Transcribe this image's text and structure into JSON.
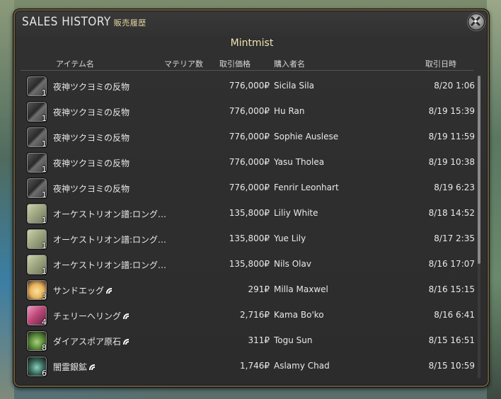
{
  "window": {
    "title": "SALES HISTORY",
    "title_jp": "販売履歴",
    "retainer_name": "Mintmist"
  },
  "columns": {
    "item": "アイテム名",
    "materia": "マテリア数",
    "price": "取引価格",
    "buyer": "購入者名",
    "datetime": "取引日時"
  },
  "rows": [
    {
      "icon": "cloth-bolt-icon",
      "qty": "1",
      "name": "夜神ツクヨミの反物",
      "hq": false,
      "price": "776,000₽",
      "buyer": "Sicila Sila",
      "date": "8/20 1:06"
    },
    {
      "icon": "cloth-bolt-icon",
      "qty": "1",
      "name": "夜神ツクヨミの反物",
      "hq": false,
      "price": "776,000₽",
      "buyer": "Hu Ran",
      "date": "8/19 15:39"
    },
    {
      "icon": "cloth-bolt-icon",
      "qty": "1",
      "name": "夜神ツクヨミの反物",
      "hq": false,
      "price": "776,000₽",
      "buyer": "Sophie Auslese",
      "date": "8/19 11:59"
    },
    {
      "icon": "cloth-bolt-icon",
      "qty": "1",
      "name": "夜神ツクヨミの反物",
      "hq": false,
      "price": "776,000₽",
      "buyer": "Yasu Tholea",
      "date": "8/19 10:38"
    },
    {
      "icon": "cloth-bolt-icon",
      "qty": "1",
      "name": "夜神ツクヨミの反物",
      "hq": false,
      "price": "776,000₽",
      "buyer": "Fenrir Leonhart",
      "date": "8/19 6:23"
    },
    {
      "icon": "orchestrion-scroll-icon",
      "qty": "1",
      "name": "オーケストリオン譜:ロング…",
      "hq": false,
      "price": "135,800₽",
      "buyer": "Liliy White",
      "date": "8/18 14:52"
    },
    {
      "icon": "orchestrion-scroll-icon",
      "qty": "1",
      "name": "オーケストリオン譜:ロング…",
      "hq": false,
      "price": "135,800₽",
      "buyer": "Yue Lily",
      "date": "8/17 2:35"
    },
    {
      "icon": "orchestrion-scroll-icon",
      "qty": "1",
      "name": "オーケストリオン譜:ロング…",
      "hq": false,
      "price": "135,800₽",
      "buyer": "Nils Olav",
      "date": "8/16 17:07"
    },
    {
      "icon": "egg-icon",
      "qty": "3",
      "name": "サンドエッグ",
      "hq": true,
      "price": "291₽",
      "buyer": "Milla Maxwel",
      "date": "8/16 15:15"
    },
    {
      "icon": "ring-icon",
      "qty": "4",
      "name": "チェリーへリング",
      "hq": true,
      "price": "2,716₽",
      "buyer": "Kama Bo'ko",
      "date": "8/16 6:41"
    },
    {
      "icon": "ore-green-icon",
      "qty": "8",
      "name": "ダイアスポア原石",
      "hq": true,
      "price": "311₽",
      "buyer": "Togu Sun",
      "date": "8/15 16:51"
    },
    {
      "icon": "ore-dark-icon",
      "qty": "6",
      "name": "闇霊銀鉱",
      "hq": true,
      "price": "1,746₽",
      "buyer": "Aslamy Chad",
      "date": "8/15 10:59"
    }
  ]
}
